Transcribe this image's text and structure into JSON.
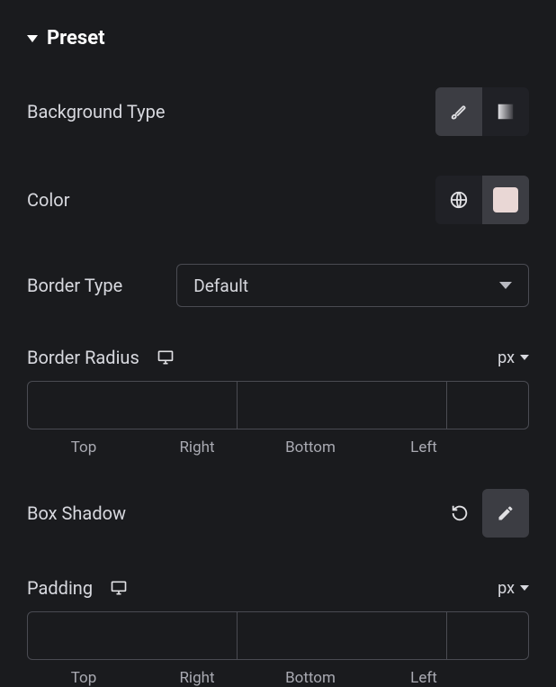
{
  "section": {
    "title": "Preset"
  },
  "background_type": {
    "label": "Background Type"
  },
  "color": {
    "label": "Color",
    "swatch": "#e9d7d5"
  },
  "border_type": {
    "label": "Border Type",
    "value": "Default"
  },
  "border_radius": {
    "label": "Border Radius",
    "unit": "px",
    "sides": [
      "Top",
      "Right",
      "Bottom",
      "Left"
    ]
  },
  "box_shadow": {
    "label": "Box Shadow"
  },
  "padding": {
    "label": "Padding",
    "unit": "px",
    "sides": [
      "Top",
      "Right",
      "Bottom",
      "Left"
    ]
  }
}
